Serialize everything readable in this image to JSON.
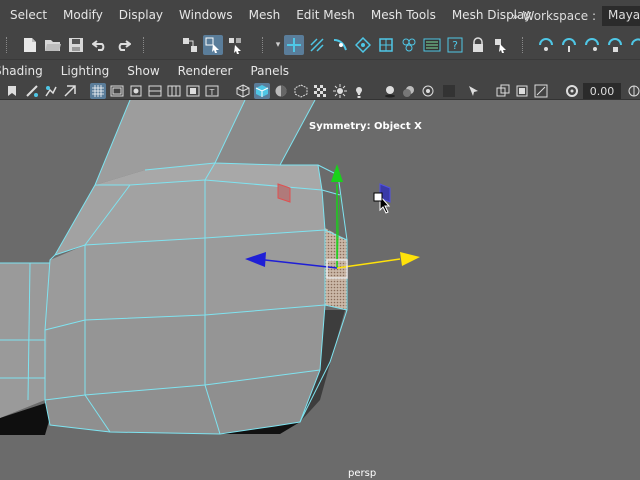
{
  "menu": {
    "items": [
      "Select",
      "Modify",
      "Display",
      "Windows",
      "Mesh",
      "Edit Mesh",
      "Mesh Tools",
      "Mesh Display"
    ]
  },
  "workspace": {
    "chevron": "»",
    "label": "Workspace :",
    "value": "Maya Classic"
  },
  "panel_menu": {
    "items": [
      "Shading",
      "Lighting",
      "Show",
      "Renderer",
      "Panels"
    ]
  },
  "panel_toolbar": {
    "field_value": "0.00"
  },
  "viewport": {
    "symmetry_label": "Symmetry: Object X",
    "camera_label": "persp",
    "background_color": "#6b6b6b",
    "wireframe_color": "#7fe3f0",
    "axis_colors": {
      "x": "#ffe20a",
      "y": "#19d21b",
      "z": "#1f1fd6"
    }
  },
  "icons": {
    "toolbar": [
      "mode-dropdown-icon",
      "new-scene-icon",
      "open-scene-icon",
      "save-scene-icon",
      "undo-icon",
      "redo-icon",
      "select-hierarchy-icon",
      "select-object-icon",
      "select-component-icon",
      "lock-selection-icon",
      "snap-grid-icon",
      "snap-curve-icon",
      "snap-point-icon",
      "snap-view-plane-icon",
      "snap-live-icon",
      "render-icon",
      "ipr-render-icon",
      "render-settings-icon",
      "help-icon",
      "lock-icon",
      "pick-icon",
      "magnet-icon"
    ],
    "panel_toolbar": [
      "bookmark-icon",
      "select-camera-icon",
      "camera-attributes-icon",
      "grid-icon",
      "film-gate-icon",
      "resolution-gate-icon",
      "wireframe-icon",
      "smooth-shade-icon",
      "textured-icon",
      "lighting-icon",
      "shadows-icon",
      "isolate-icon",
      "xray-icon",
      "xray-joints-icon",
      "xray-components-icon"
    ]
  }
}
